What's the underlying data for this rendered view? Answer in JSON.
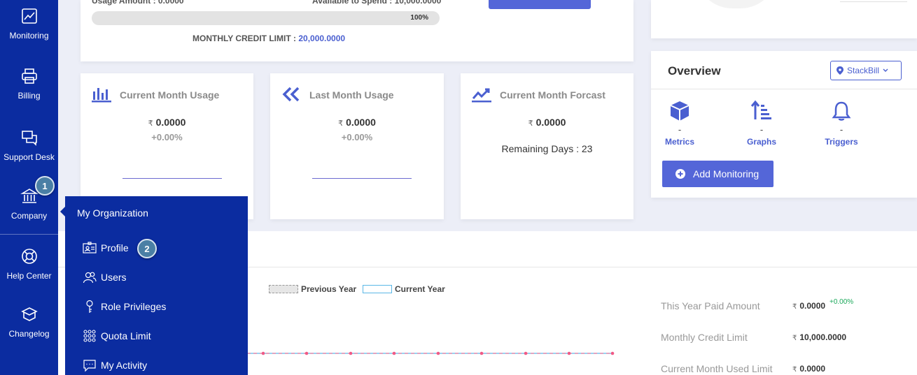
{
  "sidebar": {
    "items": [
      {
        "label": "Monitoring",
        "icon": "chart-icon"
      },
      {
        "label": "Billing",
        "icon": "printer-icon"
      },
      {
        "label": "Support Desk",
        "icon": "chat-icon"
      },
      {
        "label": "Company",
        "icon": "bank-icon"
      },
      {
        "label": "Help Center",
        "icon": "lifebuoy-icon"
      },
      {
        "label": "Changelog",
        "icon": "box-icon"
      }
    ],
    "badge": "1"
  },
  "top_card": {
    "usage_amount_label": "Usage Amount : 0.0000",
    "available_label": "Available to Spend : 10,000.0000",
    "progress_label": "100%",
    "progress_value": 100,
    "credit_limit_label": "MONTHLY CREDIT LIMIT :",
    "credit_limit_value": "20,000.0000"
  },
  "usage_cards": [
    {
      "title": "Current Month Usage",
      "currency": "₹",
      "value": "0.0000",
      "change": "+0.00%"
    },
    {
      "title": "Last Month Usage",
      "currency": "₹",
      "value": "0.0000",
      "change": "+0.00%"
    },
    {
      "title": "Current Month Forcast",
      "currency": "₹",
      "value": "0.0000",
      "remaining": "Remaining Days : 23"
    }
  ],
  "overview": {
    "title": "Overview",
    "select_value": "StackBill",
    "items": [
      {
        "label": "Metrics",
        "value": "-",
        "icon": "cube-icon"
      },
      {
        "label": "Graphs",
        "value": "-",
        "icon": "sort-icon"
      },
      {
        "label": "Triggers",
        "value": "-",
        "icon": "bell-icon"
      }
    ],
    "add_button": "Add Monitoring"
  },
  "chart": {
    "legend": [
      {
        "name": "Previous Year"
      },
      {
        "name": "Current Year"
      }
    ]
  },
  "stats": [
    {
      "label": "This Year Paid Amount",
      "currency": "₹",
      "value": "0.0000",
      "delta": "+0.00%"
    },
    {
      "label": "Monthly Credit Limit",
      "currency": "₹",
      "value": "10,000.0000"
    },
    {
      "label": "Current Month Used Limit",
      "currency": "₹",
      "value": "0.0000"
    }
  ],
  "dropdown": {
    "title": "My Organization",
    "badge": "2",
    "items": [
      {
        "label": "Profile",
        "icon": "id-card-icon"
      },
      {
        "label": "Users",
        "icon": "users-icon"
      },
      {
        "label": "Role Privileges",
        "icon": "key-icon"
      },
      {
        "label": "Quota Limit",
        "icon": "grid-dots-icon"
      },
      {
        "label": "My Activity",
        "icon": "message-icon"
      }
    ]
  },
  "colors": {
    "sidebar": "#0b2ca0",
    "accent": "#5466d8",
    "link": "#4a5fd0",
    "positive": "#1aa85a"
  }
}
